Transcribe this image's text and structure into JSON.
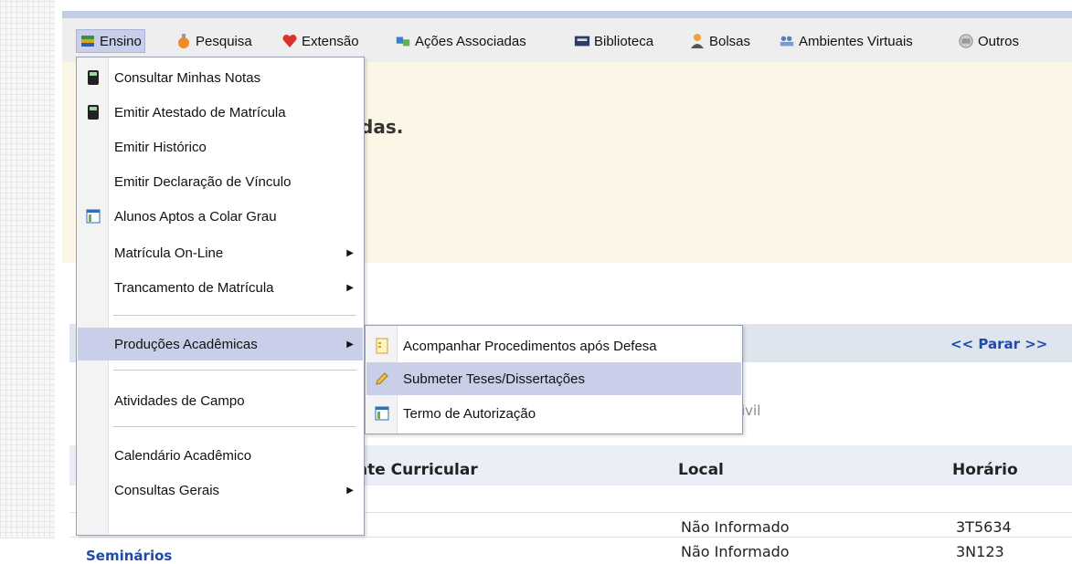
{
  "menubar": {
    "items": [
      {
        "label": "Ensino",
        "icon": "books-icon"
      },
      {
        "label": "Pesquisa",
        "icon": "flask-icon"
      },
      {
        "label": "Extensão",
        "icon": "heart-icon"
      },
      {
        "label": "Ações Associadas",
        "icon": "puzzle-icon"
      },
      {
        "label": "Biblioteca",
        "icon": "printer-icon"
      },
      {
        "label": "Bolsas",
        "icon": "person-icon"
      },
      {
        "label": "Ambientes Virtuais",
        "icon": "people-icon"
      },
      {
        "label": "Outros",
        "icon": "box-icon"
      }
    ]
  },
  "welcome": {
    "text": "das."
  },
  "ensino_menu": {
    "items": [
      {
        "label": "Consultar Minhas Notas",
        "icon": "calculator-icon"
      },
      {
        "label": "Emitir Atestado de Matrícula",
        "icon": "calculator-icon"
      },
      {
        "label": "Emitir Histórico"
      },
      {
        "label": "Emitir Declaração de Vínculo"
      },
      {
        "label": "Alunos Aptos a Colar Grau",
        "icon": "table-icon"
      },
      {
        "label": "Matrícula On-Line",
        "has_submenu": true
      },
      {
        "label": "Trancamento de Matrícula",
        "has_submenu": true
      },
      {
        "label": "Produções Acadêmicas",
        "has_submenu": true,
        "highlighted": true
      },
      {
        "label": "Atividades de Campo"
      },
      {
        "label": "Calendário Acadêmico"
      },
      {
        "label": "Consultas Gerais",
        "has_submenu": true
      }
    ]
  },
  "producoes_submenu": {
    "items": [
      {
        "label": "Acompanhar Procedimentos após Defesa",
        "icon": "document-icon"
      },
      {
        "label": "Submeter Teses/Dissertações",
        "icon": "pencil-icon",
        "highlighted": true
      },
      {
        "label": "Termo de Autorização",
        "icon": "table-icon"
      }
    ]
  },
  "content": {
    "parar_link": "<< Parar >>",
    "partial_text": "ivil",
    "table": {
      "headers": [
        "nte Curricular",
        "Local",
        "Horário"
      ],
      "rows": [
        {
          "component": "",
          "local": "Não Informado",
          "horario": "3T5634"
        },
        {
          "component": "Seminários",
          "local": "Não Informado",
          "horario": "3N123"
        }
      ]
    }
  },
  "colors": {
    "highlight": "#c9cfe8",
    "link": "#1f4aa8",
    "beige": "#fbf6e6"
  }
}
